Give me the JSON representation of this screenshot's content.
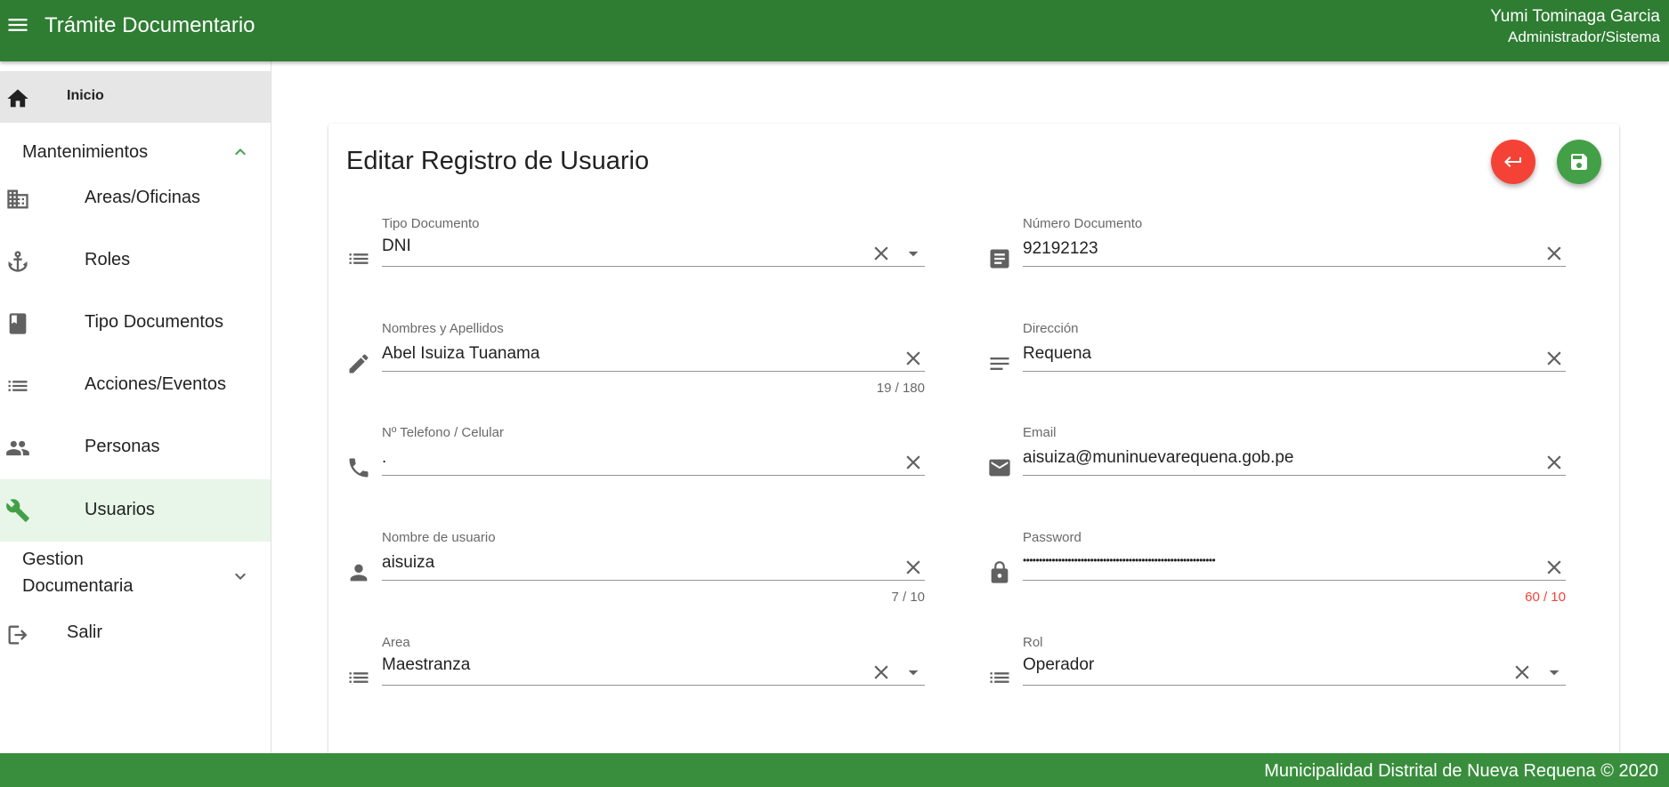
{
  "header": {
    "title": "Trámite Documentario",
    "user_name": "Yumi Tominaga Garcia",
    "user_role": "Administrador/Sistema"
  },
  "sidebar": {
    "home": "Inicio",
    "group_mantenimientos": "Mantenimientos",
    "items": [
      {
        "label": "Areas/Oficinas",
        "icon": "building-icon"
      },
      {
        "label": "Roles",
        "icon": "anchor-icon"
      },
      {
        "label": "Tipo Documentos",
        "icon": "book-icon"
      },
      {
        "label": "Acciones/Eventos",
        "icon": "list-icon"
      },
      {
        "label": "Personas",
        "icon": "people-icon"
      },
      {
        "label": "Usuarios",
        "icon": "wrench-icon"
      }
    ],
    "group_gestion_line1": "Gestion",
    "group_gestion_line2": "Documentaria",
    "logout": "Salir",
    "active_color": "#43a047"
  },
  "form": {
    "title": "Editar Registro de Usuario",
    "tipo_documento": {
      "label": "Tipo Documento",
      "value": "DNI"
    },
    "numero_documento": {
      "label": "Número Documento",
      "value": "92192123"
    },
    "nombres": {
      "label": "Nombres y Apellidos",
      "value": "Abel Isuiza Tuanama",
      "counter": "19 / 180"
    },
    "direccion": {
      "label": "Dirección",
      "value": "Requena"
    },
    "telefono": {
      "label": "Nº Telefono / Celular",
      "value": "."
    },
    "email": {
      "label": "Email",
      "value": "aisuiza@muninuevarequena.gob.pe"
    },
    "usuario": {
      "label": "Nombre de usuario",
      "value": "aisuiza",
      "counter": "7 / 10"
    },
    "password": {
      "label": "Password",
      "value": "••••••••••••••••••••••••••••••••••••••••••••••••••••••••••••",
      "counter": "60 / 10"
    },
    "area": {
      "label": "Area",
      "value": "Maestranza"
    },
    "rol": {
      "label": "Rol",
      "value": "Operador"
    }
  },
  "colors": {
    "header_bg": "#2e7d32",
    "footer_bg": "#388e3c",
    "back_button": "#f44336",
    "save_button": "#43a047",
    "error": "#f44336"
  },
  "footer": {
    "text": "Municipalidad Distrital de Nueva Requena © 2020"
  }
}
